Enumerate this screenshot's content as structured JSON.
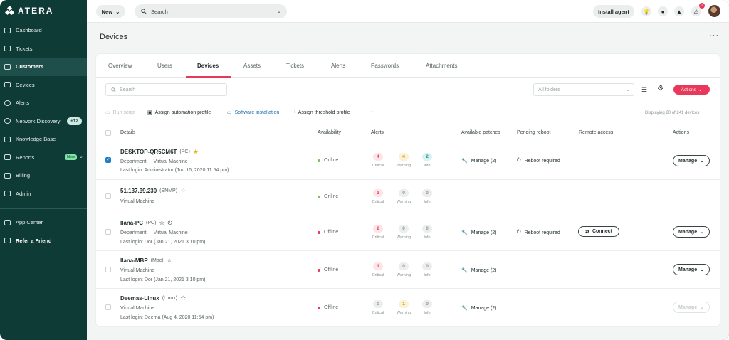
{
  "brand": {
    "logo_text": "ATERA"
  },
  "sidebar": {
    "items": [
      {
        "label": "Dashboard",
        "icon": "grid-icon"
      },
      {
        "label": "Tickets",
        "icon": "ticket-icon"
      },
      {
        "label": "Customers",
        "icon": "building-icon",
        "active": true
      },
      {
        "label": "Devices",
        "icon": "monitor-icon"
      },
      {
        "label": "Alerts",
        "icon": "alert-icon"
      },
      {
        "label": "Network Discovery",
        "icon": "network-icon",
        "badge": "+12"
      },
      {
        "label": "Knowledge Base",
        "icon": "book-icon"
      },
      {
        "label": "Reports",
        "icon": "reports-icon",
        "tag": "New"
      },
      {
        "label": "Billing",
        "icon": "billing-icon"
      },
      {
        "label": "Admin",
        "icon": "sliders-icon"
      }
    ],
    "bottom_items": [
      {
        "label": "App Center",
        "icon": "apps-icon"
      },
      {
        "label": "Refer a Friend",
        "icon": "gift-icon"
      }
    ]
  },
  "topbar": {
    "new_label": "New",
    "search_placeholder": "Search",
    "install_label": "Install agent",
    "notification_count": "1"
  },
  "page": {
    "title": "Devices",
    "more": "···"
  },
  "tabs": [
    "Overview",
    "Users",
    "Devices",
    "Assets",
    "Tickets",
    "Alerts",
    "Passwords",
    "Attachments"
  ],
  "active_tab": "Devices",
  "filters": {
    "search_placeholder": "Search",
    "folders_placeholder": "All folders",
    "actions_label": "Actions"
  },
  "toolbar": {
    "run_script": "Run script",
    "assign_automation": "Assign automation profile",
    "software_installation": "Software installation",
    "assign_threshold": "Assign threshold profile",
    "more": "···",
    "displaying": "Displaying 20 of 241 devices"
  },
  "table": {
    "headers": {
      "details": "Details",
      "availability": "Availability",
      "alerts": "Alerts",
      "patches": "Available patches",
      "reboot": "Pending reboot",
      "remote": "Remote access",
      "actions": "Actions"
    },
    "alert_labels": {
      "critical": "Critical",
      "warning": "Warning",
      "info": "Info"
    },
    "rows": [
      {
        "name": "DESKTOP-QR5CM6T",
        "type": "(PC)",
        "star": "filled",
        "dept": "Department",
        "kind": "Virtual Machine",
        "login": "Last login: Administrator (Jun 16, 2020 11:54 pm)",
        "status": "Online",
        "critical": "4",
        "warning": "4",
        "info": "2",
        "patches": "Manage (2)",
        "reboot": "Reboot required",
        "connect": "",
        "manage": "Manage",
        "checked": true
      },
      {
        "name": "51.137.39.230",
        "type": "(SNMP)",
        "star": "faint",
        "dept": "",
        "kind": "Virtual Machine",
        "login": "",
        "status": "Online",
        "critical": "3",
        "warning": "0",
        "info": "0",
        "patches": "",
        "reboot": "",
        "connect": "",
        "manage": "",
        "checked": false
      },
      {
        "name": "Ilana-PC",
        "type": "(PC)",
        "star": "outline",
        "dept": "Department",
        "kind": "Virtual Machine",
        "login": "Last login: Dor (Jan 21, 2021 3:10 pm)",
        "status": "Offline",
        "critical": "2",
        "warning": "0",
        "info": "0",
        "patches": "Manage (2)",
        "reboot": "Reboot required",
        "connect": "Connect",
        "manage": "Manage",
        "checked": false
      },
      {
        "name": "Ilana-MBP",
        "type": "(Mac)",
        "star": "outline",
        "dept": "",
        "kind": "Virtual Machine",
        "login": "Last login: Dor (Jan 21, 2021 3:10 pm)",
        "status": "Offline",
        "critical": "1",
        "warning": "0",
        "info": "0",
        "patches": "Manage (2)",
        "reboot": "",
        "connect": "",
        "manage": "Manage",
        "checked": false
      },
      {
        "name": "Deemas-Linux",
        "type": "(Linux)",
        "star": "outline",
        "dept": "",
        "kind": "Virtual Machine",
        "login": "Last login: Deema (Aug 4, 2020 11:54 pm)",
        "status": "Offline",
        "critical": "0",
        "warning": "1",
        "info": "0",
        "patches": "Manage (2)",
        "reboot": "",
        "connect": "",
        "manage": "Manage",
        "manage_disabled": true,
        "checked": false
      }
    ]
  },
  "colors": {
    "sidebar": "#0f3b37",
    "accent": "#e8395b",
    "online": "#7cc25a",
    "offline": "#e8395b",
    "link": "#1f6fa8"
  }
}
